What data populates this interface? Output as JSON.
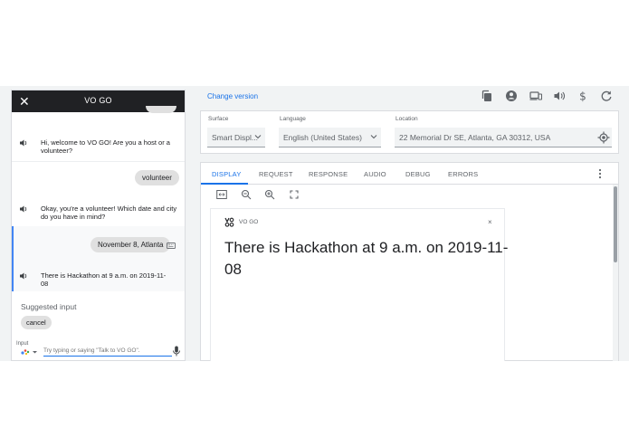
{
  "chat": {
    "title": "VO GO",
    "messages": [
      {
        "role": "bot",
        "text": "Hi, welcome to VO GO! Are you a host or a volunteer?"
      },
      {
        "role": "user",
        "text": "volunteer"
      },
      {
        "role": "bot",
        "text": "Okay, you're a volunteer! Which date and city do you have in mind?"
      },
      {
        "role": "user",
        "text": "November 8, Atlanta"
      },
      {
        "role": "bot",
        "text": "There is Hackathon at 9 a.m. on 2019-11-08"
      }
    ],
    "suggested_label": "Suggested input",
    "suggestions": [
      "cancel"
    ],
    "input_label": "Input",
    "input_placeholder": "Try typing or saying \"Talk to VO GO\"."
  },
  "toolbar": {
    "change_version": "Change version",
    "icons": [
      "copy-icon",
      "account-icon",
      "devices-icon",
      "volume-icon",
      "dollar-icon",
      "refresh-icon"
    ]
  },
  "settings": {
    "surface_label": "Surface",
    "surface_value": "Smart Displ...",
    "language_label": "Language",
    "language_value": "English (United States)",
    "location_label": "Location",
    "location_value": "22 Memorial Dr SE, Atlanta, GA 30312, USA"
  },
  "tabs": [
    "DISPLAY",
    "REQUEST",
    "RESPONSE",
    "AUDIO",
    "DEBUG",
    "ERRORS"
  ],
  "active_tab": "DISPLAY",
  "display": {
    "app_name": "VO GO",
    "close": "×",
    "text": "There is Hackathon at 9 a.m. on 2019-11-08"
  },
  "colors": {
    "accent": "#1a73e8",
    "header_bg": "#202124",
    "bubble_bg": "#e0e0e0",
    "panel_bg": "#f1f3f4"
  }
}
